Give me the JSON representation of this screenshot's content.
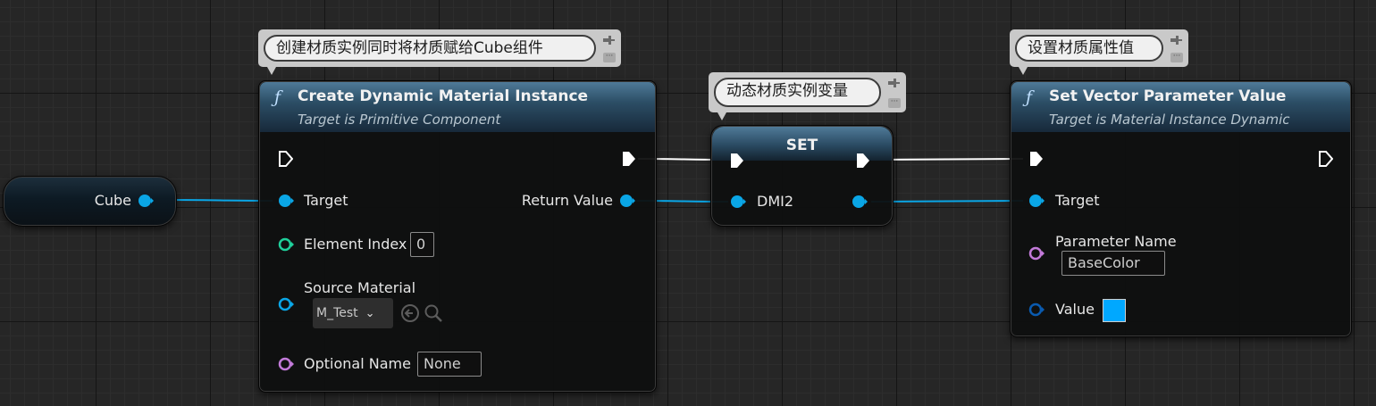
{
  "comments": {
    "create": "创建材质实例同时将材质赋给Cube组件",
    "set_var": "动态材质实例变量",
    "set_param": "设置材质属性值"
  },
  "variable_node": {
    "name": "Cube"
  },
  "create_node": {
    "glyph": "ƒ",
    "title": "Create Dynamic Material Instance",
    "subtitle": "Target is Primitive Component",
    "pins": {
      "target": "Target",
      "element_index": "Element Index",
      "element_index_value": "0",
      "source_material": "Source Material",
      "source_material_value": "M_Test",
      "optional_name": "Optional Name",
      "optional_name_value": "None",
      "return_value": "Return Value"
    }
  },
  "set_node": {
    "title": "SET",
    "variable": "DMI2"
  },
  "param_node": {
    "glyph": "ƒ",
    "title": "Set Vector Parameter Value",
    "subtitle": "Target is Material Instance Dynamic",
    "pins": {
      "target": "Target",
      "parameter_name": "Parameter Name",
      "parameter_name_value": "BaseColor",
      "value": "Value"
    },
    "value_color": "#00a8ff"
  },
  "colors": {
    "object_pin": "#0aa6e6",
    "integer_pin": "#1fcf9a",
    "name_pin": "#c27ad9",
    "struct_pin": "#0a5bb0",
    "exec_wire": "#ffffff"
  }
}
